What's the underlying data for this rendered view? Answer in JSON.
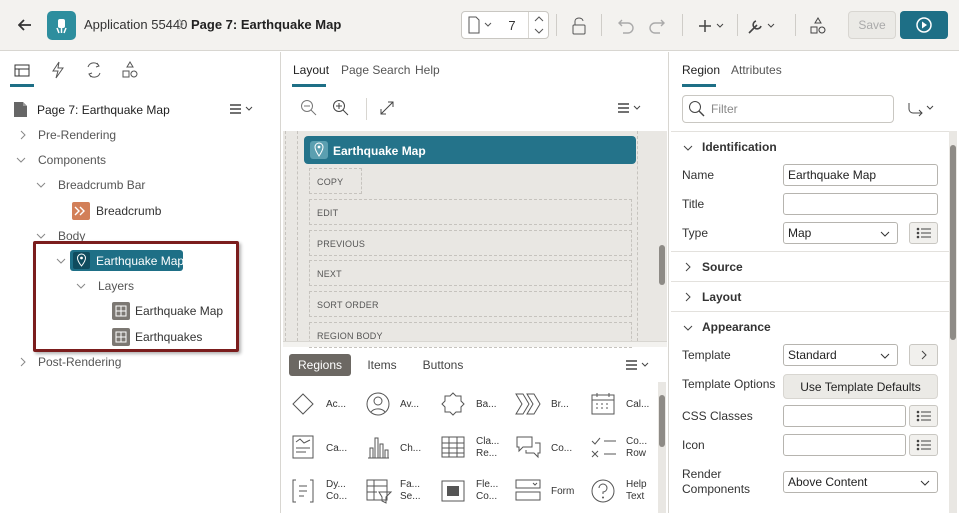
{
  "header": {
    "app_title": "Application 55440",
    "page_title": "Page 7: Earthquake Map",
    "page_number": "7",
    "save_label": "Save"
  },
  "left": {
    "page_node": "Page 7: Earthquake Map",
    "tree": {
      "pre_rendering": "Pre-Rendering",
      "components": "Components",
      "breadcrumb_bar": "Breadcrumb Bar",
      "breadcrumb": "Breadcrumb",
      "body": "Body",
      "earthquake_map": "Earthquake Map",
      "layers": "Layers",
      "layer1": "Earthquake Map",
      "layer2": "Earthquakes",
      "post_rendering": "Post-Rendering"
    }
  },
  "middle": {
    "tabs": [
      "Layout",
      "Page Search",
      "Help"
    ],
    "region_title": "Earthquake Map",
    "slots": [
      "COPY",
      "EDIT",
      "PREVIOUS",
      "NEXT",
      "SORT ORDER",
      "REGION BODY"
    ],
    "gallery_tabs": [
      "Regions",
      "Items",
      "Buttons"
    ],
    "gallery": [
      [
        "Ac...",
        "Av...",
        "Ba...",
        "Br...",
        "Cal..."
      ],
      [
        "Ca...",
        "Ch...",
        "Cla...|Re...",
        "Co...",
        "Co...|Row"
      ],
      [
        "Dy...|Co...",
        "Fa...|Se...",
        "Fle...|Co...",
        "Form",
        "Help|Text"
      ]
    ]
  },
  "right": {
    "tabs": [
      "Region",
      "Attributes"
    ],
    "filter_placeholder": "Filter",
    "groups": {
      "identification": "Identification",
      "source": "Source",
      "layout": "Layout",
      "appearance": "Appearance"
    },
    "labels": {
      "name": "Name",
      "title": "Title",
      "type": "Type",
      "template": "Template",
      "template_options": "Template Options",
      "css_classes": "CSS Classes",
      "icon": "Icon",
      "render_1": "Render",
      "render_2": "Components"
    },
    "values": {
      "name": "Earthquake Map",
      "title": "",
      "type": "Map",
      "template": "Standard",
      "template_defaults_btn": "Use Template Defaults",
      "css_classes": "",
      "icon": "",
      "render_components": "Above Content"
    }
  }
}
